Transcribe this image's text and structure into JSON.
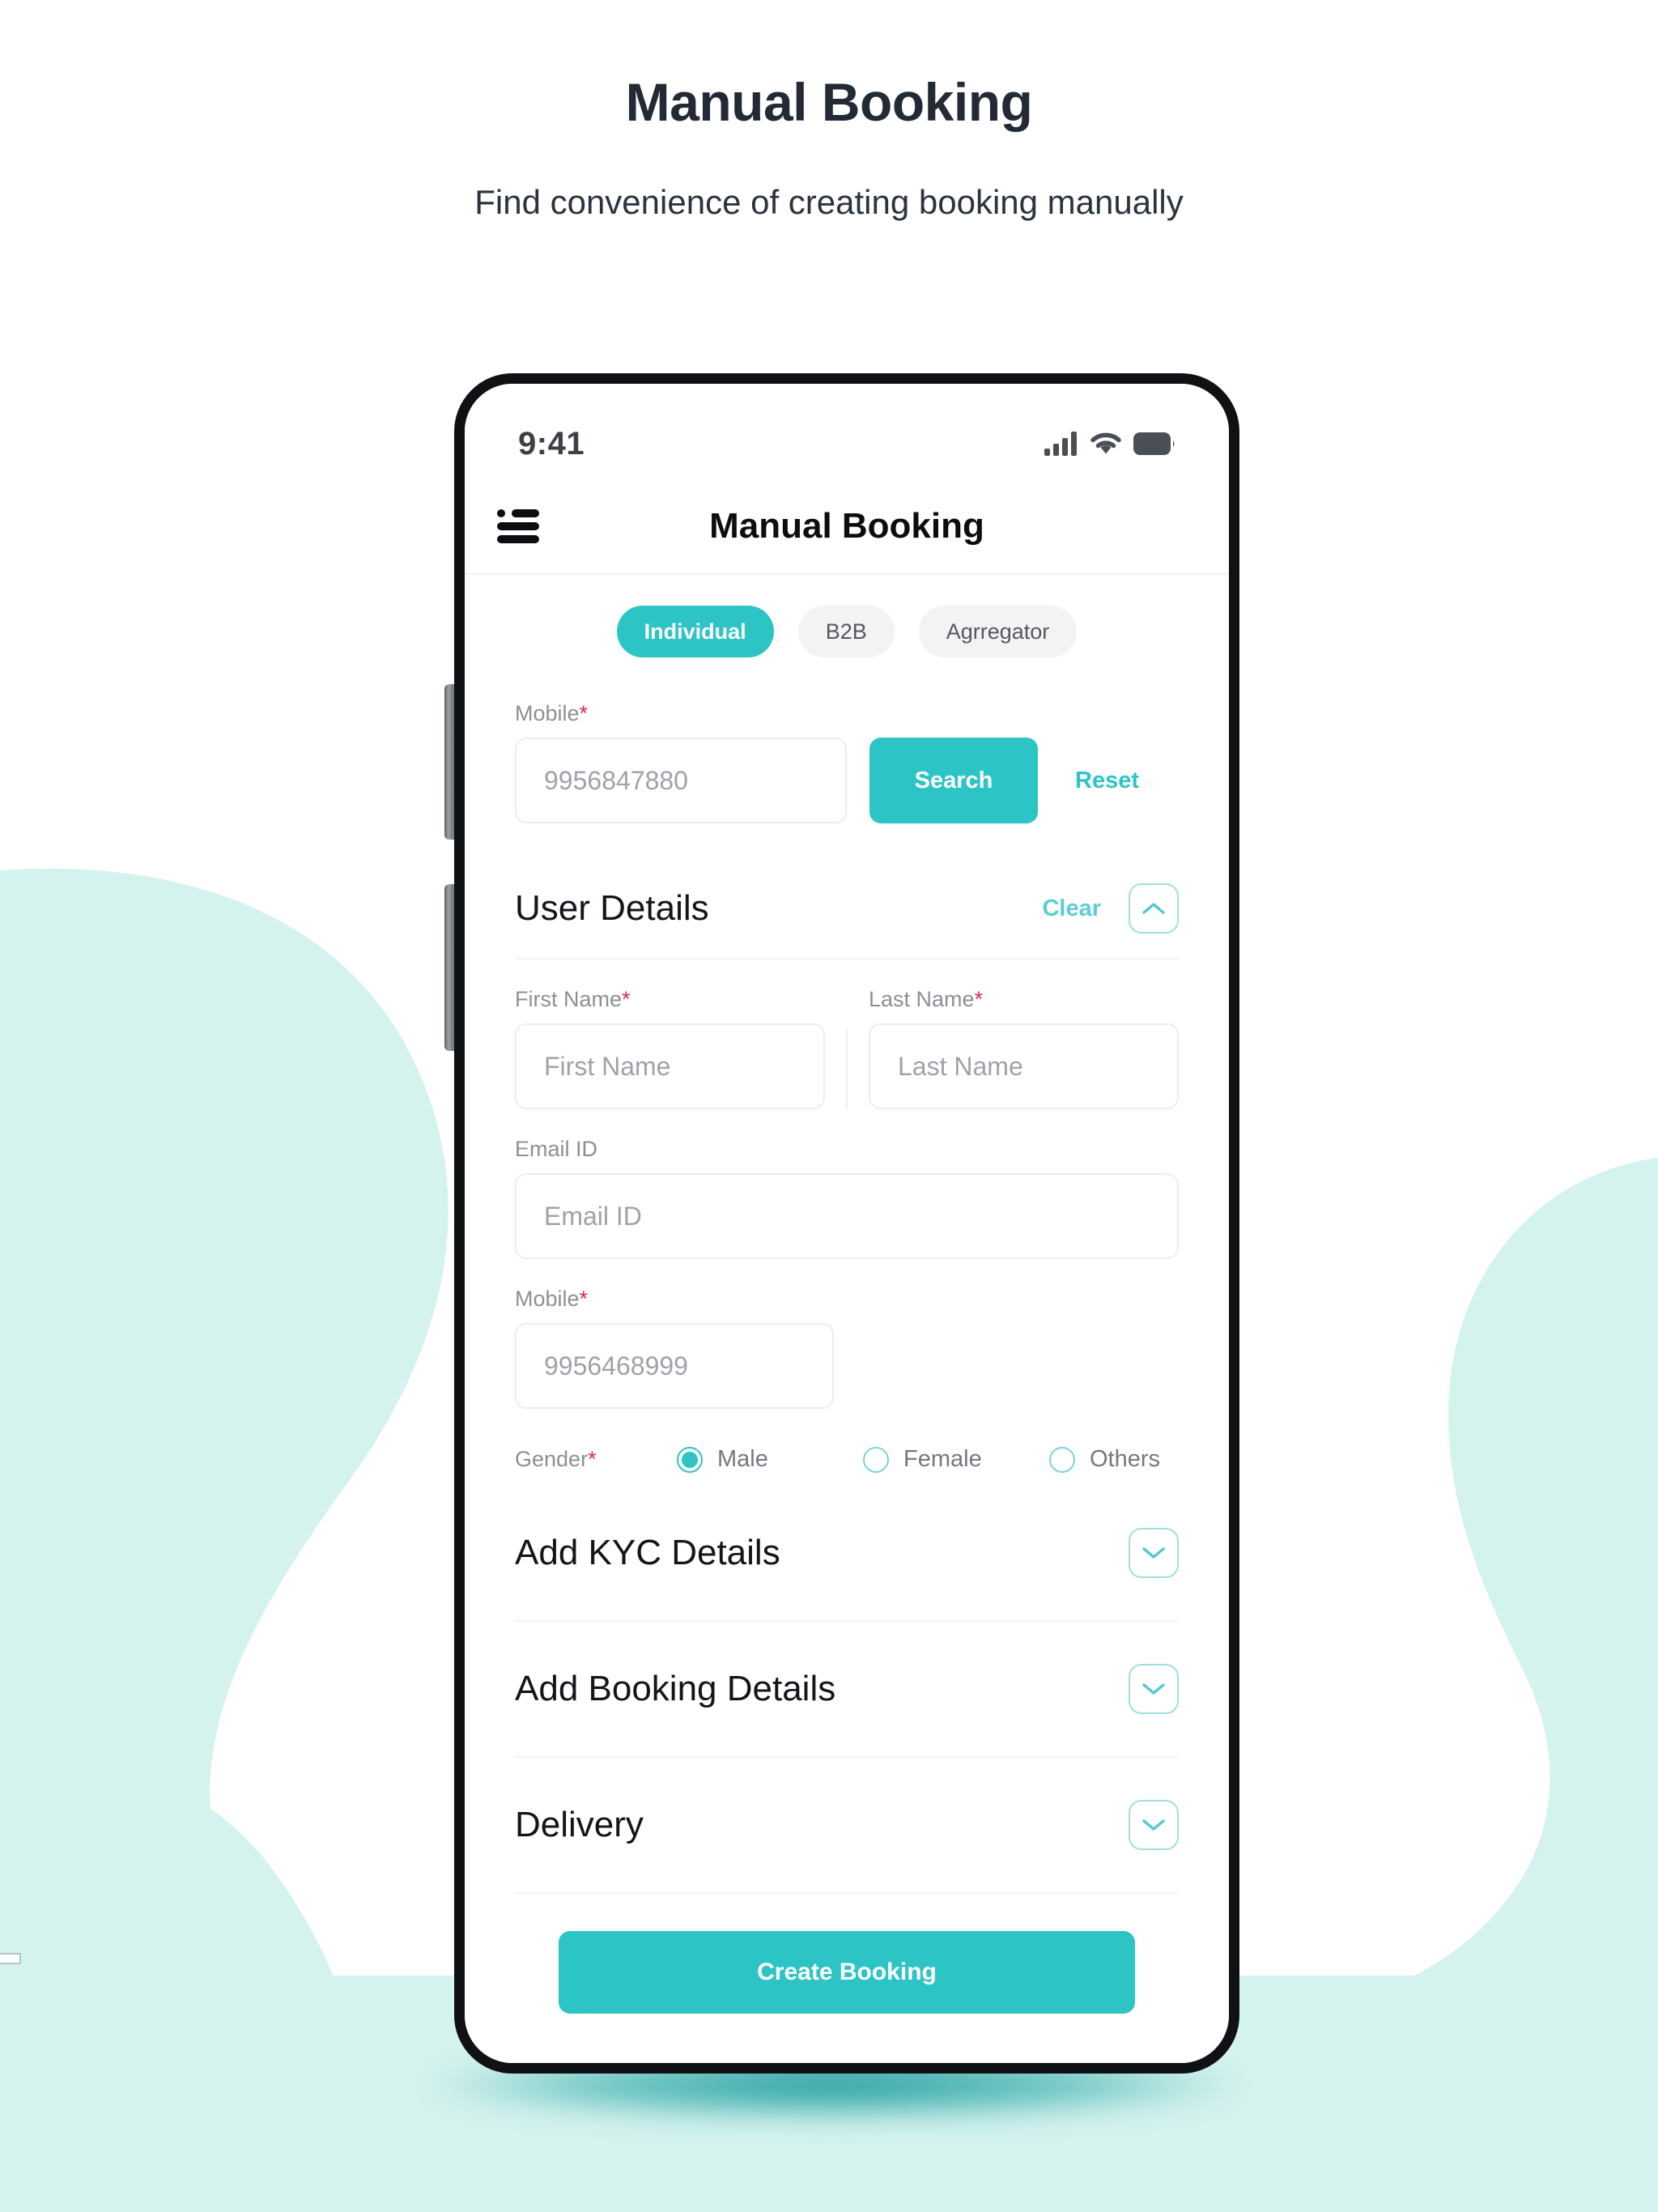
{
  "page": {
    "title": "Manual Booking",
    "subtitle": "Find convenience of creating booking manually"
  },
  "colors": {
    "accent": "#2DC4C6",
    "accent_light": "#9EDFE2",
    "blob": "#D4F2EE",
    "required": "#E02B45",
    "heading": "#242A35"
  },
  "phone": {
    "status_bar": {
      "time": "9:41",
      "signal_icon": "cellular-signal-icon",
      "wifi_icon": "wifi-icon",
      "battery_icon": "battery-icon"
    },
    "header": {
      "menu_icon": "hamburger-menu-icon",
      "title": "Manual Booking"
    },
    "tabs": [
      {
        "label": "Individual",
        "active": true
      },
      {
        "label": "B2B",
        "active": false
      },
      {
        "label": "Agrregator",
        "active": false
      }
    ],
    "search_section": {
      "mobile_label": "Mobile",
      "mobile_required": "*",
      "mobile_placeholder": "9956847880",
      "search_label": "Search",
      "reset_label": "Reset"
    },
    "user_details": {
      "title": "User Details",
      "clear_label": "Clear",
      "collapse_icon": "chevron-up-icon",
      "first_name": {
        "label": "First Name",
        "required": "*",
        "placeholder": "First Name"
      },
      "last_name": {
        "label": "Last Name",
        "required": "*",
        "placeholder": "Last Name"
      },
      "email": {
        "label": "Email ID",
        "placeholder": "Email ID"
      },
      "mobile": {
        "label": "Mobile",
        "required": "*",
        "placeholder": "9956468999"
      },
      "gender": {
        "label": "Gender",
        "required": "*",
        "options": [
          {
            "label": "Male",
            "selected": true
          },
          {
            "label": "Female",
            "selected": false
          },
          {
            "label": "Others",
            "selected": false
          }
        ]
      }
    },
    "accordions": [
      {
        "title": "Add KYC Details",
        "icon": "chevron-down-icon"
      },
      {
        "title": "Add Booking Details",
        "icon": "chevron-down-icon"
      },
      {
        "title": "Delivery",
        "icon": "chevron-down-icon"
      }
    ],
    "cta": {
      "label": "Create Booking"
    }
  }
}
